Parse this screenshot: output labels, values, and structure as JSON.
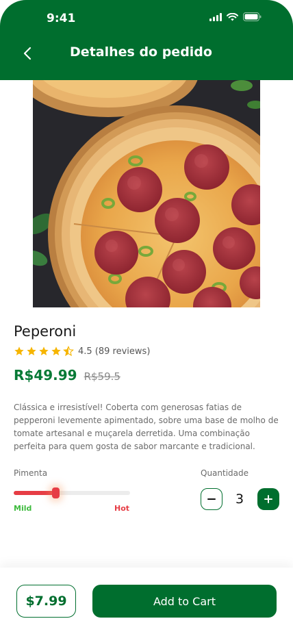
{
  "status_bar": {
    "time": "9:41"
  },
  "header": {
    "title": "Detalhes do pedido"
  },
  "product": {
    "name": "Peperoni",
    "rating": 4.5,
    "rating_text": "4.5 (89 reviews)",
    "price": "R$49.99",
    "old_price": "R$59.5",
    "description": "Clássica e irresistível! Coberta com generosas fatias de pepperoni levemente apimentado, sobre uma base de molho de tomate artesanal e muçarela derretida. Uma combinação perfeita para quem gosta de sabor marcante e tradicional."
  },
  "pepper": {
    "label": "Pimenta",
    "level": 0.36,
    "min_label": "Mild",
    "max_label": "Hot"
  },
  "quantity": {
    "label": "Quantidade",
    "value": "3"
  },
  "footer": {
    "total": "$7.99",
    "add_button": "Add to Cart"
  },
  "colors": {
    "primary": "#006e2e",
    "price": "#077a36",
    "hot": "#e63d45",
    "mild": "#3dbb3d",
    "star": "#f6b500"
  }
}
